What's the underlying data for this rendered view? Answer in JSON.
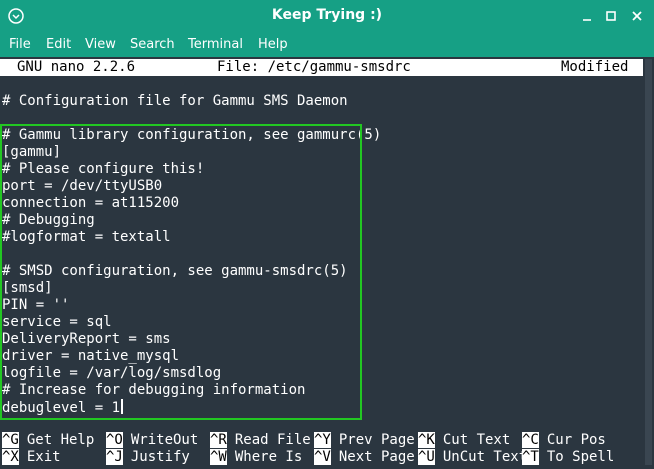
{
  "window": {
    "title": "Keep Trying :)",
    "menu_icon": "chevron-circle-icon",
    "minimize_icon": "minimize-icon",
    "maximize_icon": "maximize-icon",
    "close_icon": "close-icon"
  },
  "menubar": {
    "items": [
      "File",
      "Edit",
      "View",
      "Search",
      "Terminal",
      "Help"
    ]
  },
  "nano": {
    "version": "GNU nano 2.2.6",
    "file": "File: /etc/gammu-smsdrc",
    "status": "Modified",
    "lines": [
      "",
      "# Configuration file for Gammu SMS Daemon",
      "",
      "# Gammu library configuration, see gammurc(5)",
      "[gammu]",
      "# Please configure this!",
      "port = /dev/ttyUSB0",
      "connection = at115200",
      "# Debugging",
      "#logformat = textall",
      "",
      "# SMSD configuration, see gammu-smsdrc(5)",
      "[smsd]",
      "PIN = ''",
      "service = sql",
      "DeliveryReport = sms",
      "driver = native_mysql",
      "logfile = /var/log/smsdlog",
      "# Increase for debugging information",
      "debuglevel = 1"
    ],
    "shortcuts_row1": [
      {
        "key": "^G",
        "label": "Get Help"
      },
      {
        "key": "^O",
        "label": "WriteOut"
      },
      {
        "key": "^R",
        "label": "Read File"
      },
      {
        "key": "^Y",
        "label": "Prev Page"
      },
      {
        "key": "^K",
        "label": "Cut Text"
      },
      {
        "key": "^C",
        "label": "Cur Pos"
      }
    ],
    "shortcuts_row2": [
      {
        "key": "^X",
        "label": "Exit"
      },
      {
        "key": "^J",
        "label": "Justify"
      },
      {
        "key": "^W",
        "label": "Where Is"
      },
      {
        "key": "^V",
        "label": "Next Page"
      },
      {
        "key": "^U",
        "label": "UnCut Text"
      },
      {
        "key": "^T",
        "label": "To Spell"
      }
    ]
  },
  "colors": {
    "accent": "#16a085",
    "terminal_bg": "#2b3640",
    "highlight_border": "#22c722"
  }
}
